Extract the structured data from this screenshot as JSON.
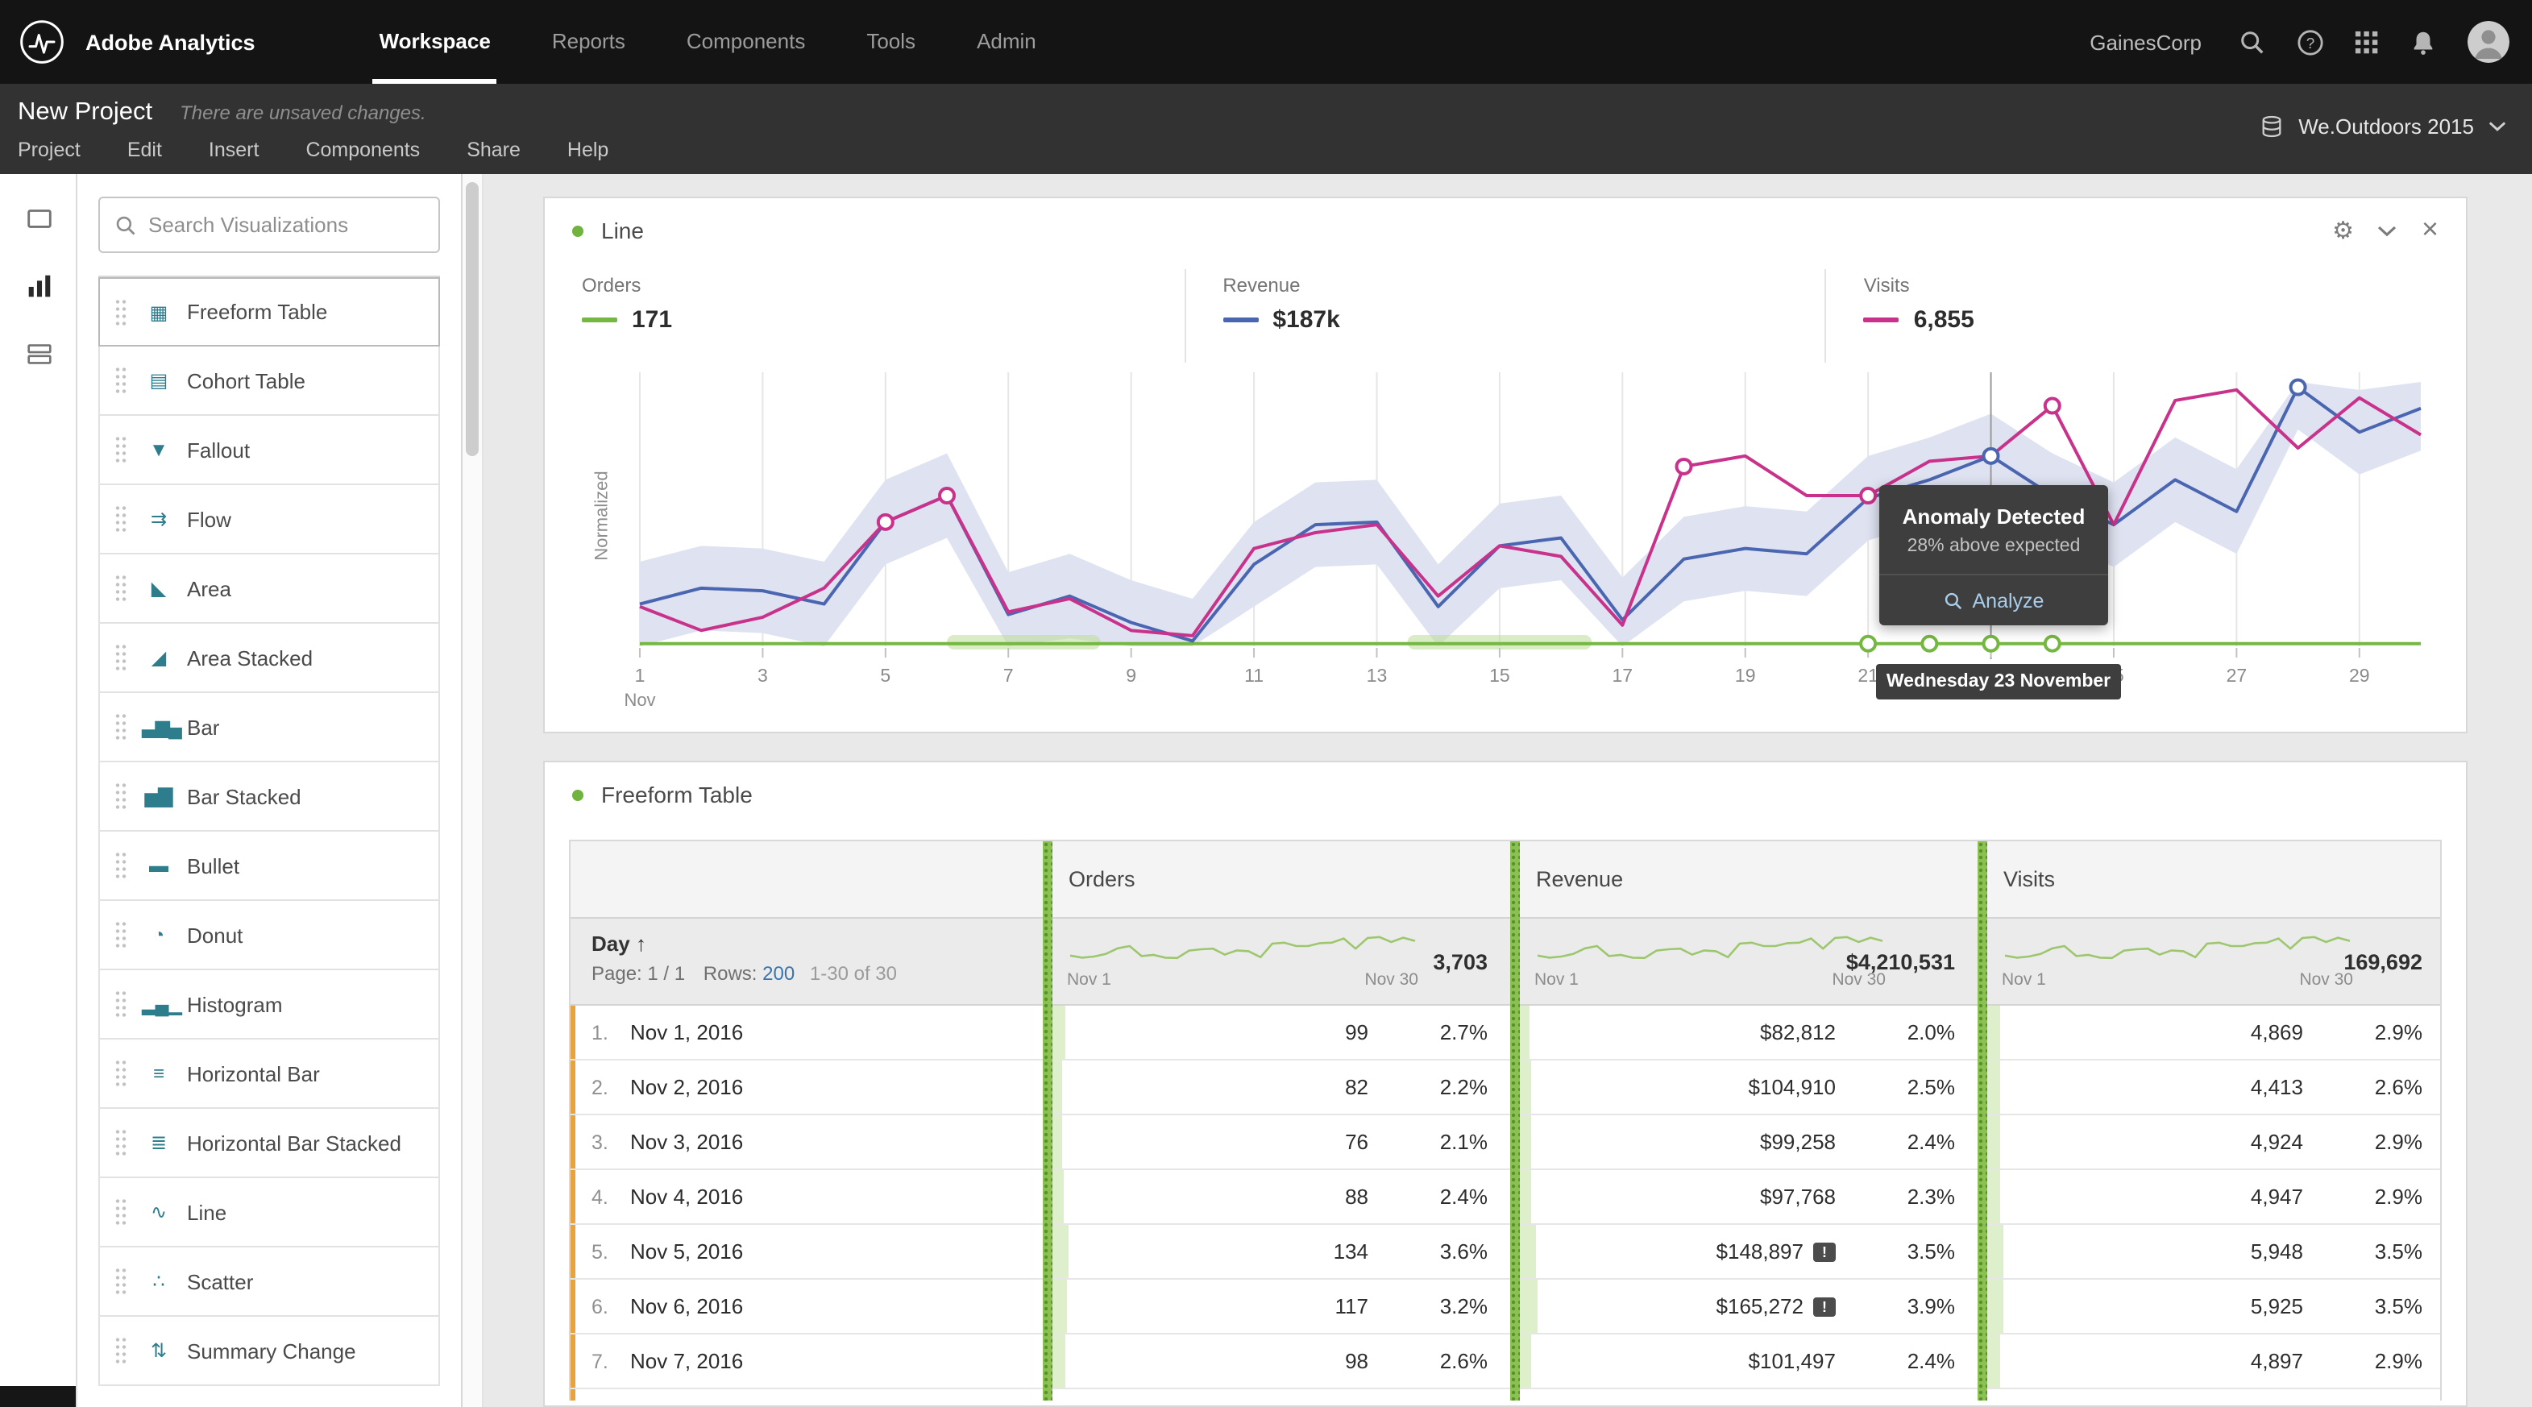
{
  "colors": {
    "green": "#75b841",
    "blue": "#4a66b0",
    "pink": "#c9328b",
    "band": "#dfe3f1",
    "orders_glow": "#bcdc96",
    "orange_accent": "#e8a33d",
    "link_blue": "#3b74ad"
  },
  "topnav": {
    "brand": "Adobe Analytics",
    "items": [
      {
        "label": "Workspace",
        "active": true
      },
      {
        "label": "Reports",
        "active": false
      },
      {
        "label": "Components",
        "active": false
      },
      {
        "label": "Tools",
        "active": false
      },
      {
        "label": "Admin",
        "active": false
      }
    ],
    "company": "GainesCorp"
  },
  "projectbar": {
    "title": "New Project",
    "unsaved_note": "There are unsaved changes.",
    "menu": [
      "Project",
      "Edit",
      "Insert",
      "Components",
      "Share",
      "Help"
    ],
    "report_suite": "We.Outdoors 2015"
  },
  "viz_panel": {
    "search_placeholder": "Search Visualizations",
    "items": [
      {
        "label": "Freeform Table",
        "icon": "freeform-table-icon",
        "glyph": "▦"
      },
      {
        "label": "Cohort Table",
        "icon": "cohort-table-icon",
        "glyph": "▤"
      },
      {
        "label": "Fallout",
        "icon": "fallout-icon",
        "glyph": "▼"
      },
      {
        "label": "Flow",
        "icon": "flow-icon",
        "glyph": "⇉"
      },
      {
        "label": "Area",
        "icon": "area-icon",
        "glyph": "◣"
      },
      {
        "label": "Area Stacked",
        "icon": "area-stacked-icon",
        "glyph": "◢"
      },
      {
        "label": "Bar",
        "icon": "bar-icon",
        "glyph": "▃▆▄"
      },
      {
        "label": "Bar Stacked",
        "icon": "bar-stacked-icon",
        "glyph": "▅▇"
      },
      {
        "label": "Bullet",
        "icon": "bullet-icon",
        "glyph": "▬"
      },
      {
        "label": "Donut",
        "icon": "donut-icon",
        "glyph": "◔"
      },
      {
        "label": "Histogram",
        "icon": "histogram-icon",
        "glyph": "▂▄▁"
      },
      {
        "label": "Horizontal Bar",
        "icon": "horizontal-bar-icon",
        "glyph": "≡"
      },
      {
        "label": "Horizontal Bar Stacked",
        "icon": "horizontal-bar-stacked-icon",
        "glyph": "≣"
      },
      {
        "label": "Line",
        "icon": "line-icon",
        "glyph": "∿"
      },
      {
        "label": "Scatter",
        "icon": "scatter-icon",
        "glyph": "∴"
      },
      {
        "label": "Summary Change",
        "icon": "summary-change-icon",
        "glyph": "⇅"
      }
    ]
  },
  "line_chart": {
    "title": "Line",
    "y_axis_label": "Normalized",
    "x_month_label": "Nov",
    "x_ticks": [
      1,
      3,
      5,
      7,
      9,
      11,
      13,
      15,
      17,
      19,
      21,
      23,
      25,
      27,
      29
    ],
    "days": 30,
    "hover_day": 23,
    "date_label": "Wednesday 23 November",
    "tooltip": {
      "title": "Anomaly Detected",
      "subtitle": "28% above expected",
      "action_label": "Analyze"
    },
    "legend": [
      {
        "name": "Orders",
        "value": "171",
        "color": "#75b841"
      },
      {
        "name": "Revenue",
        "value": "$187k",
        "color": "#4a66b0"
      },
      {
        "name": "Visits",
        "value": "6,855",
        "color": "#c9328b"
      }
    ],
    "band_offset": 16,
    "orders_band_ranges": [
      [
        6,
        8.5
      ],
      [
        13.5,
        16.5
      ]
    ],
    "series": {
      "orders": [
        1,
        1,
        1,
        1,
        1,
        1,
        1,
        1,
        1,
        1,
        1,
        1,
        1,
        1,
        1,
        1,
        1,
        1,
        1,
        1,
        1,
        1,
        1,
        1,
        1,
        1,
        1,
        1,
        1,
        1
      ],
      "revenue": [
        16,
        22,
        21,
        16,
        47,
        57,
        12,
        19,
        9,
        2,
        31,
        46,
        47,
        15,
        38,
        41,
        10,
        33,
        37,
        35,
        56,
        63,
        72,
        57,
        46,
        63,
        51,
        98,
        81,
        90
      ],
      "visits": [
        15,
        6,
        11,
        22,
        47,
        57,
        13,
        18,
        6,
        4,
        37,
        43,
        46,
        19,
        38,
        34,
        8,
        68,
        72,
        57,
        57,
        70,
        72,
        91,
        46,
        93,
        97,
        75,
        94,
        80
      ]
    },
    "anomalies": [
      {
        "series": "visits",
        "day": 5
      },
      {
        "series": "visits",
        "day": 6
      },
      {
        "series": "visits",
        "day": 18
      },
      {
        "series": "visits",
        "day": 21
      },
      {
        "series": "revenue",
        "day": 23
      },
      {
        "series": "visits",
        "day": 24
      },
      {
        "series": "revenue",
        "day": 28
      },
      {
        "series": "orders",
        "day": 21
      },
      {
        "series": "orders",
        "day": 22
      },
      {
        "series": "orders",
        "day": 23
      },
      {
        "series": "orders",
        "day": 24
      }
    ]
  },
  "freeform_table": {
    "title": "Freeform Table",
    "dim_label": "Day",
    "sort_arrow": "↑",
    "pagination_prefix": "Page: 1 / 1",
    "rows_label": "Rows:",
    "rows_value": "200",
    "range_label": "1-30 of 30",
    "spark_start_label": "Nov 1",
    "spark_end_label": "Nov 30",
    "columns": [
      {
        "name": "Orders",
        "total": "3,703"
      },
      {
        "name": "Revenue",
        "total": "$4,210,531"
      },
      {
        "name": "Visits",
        "total": "169,692"
      }
    ],
    "rows": [
      {
        "num": "1.",
        "day": "Nov 1, 2016",
        "cells": [
          {
            "v": "99",
            "p": "2.7%"
          },
          {
            "v": "$82,812",
            "p": "2.0%"
          },
          {
            "v": "4,869",
            "p": "2.9%"
          }
        ]
      },
      {
        "num": "2.",
        "day": "Nov 2, 2016",
        "cells": [
          {
            "v": "82",
            "p": "2.2%"
          },
          {
            "v": "$104,910",
            "p": "2.5%"
          },
          {
            "v": "4,413",
            "p": "2.6%"
          }
        ]
      },
      {
        "num": "3.",
        "day": "Nov 3, 2016",
        "cells": [
          {
            "v": "76",
            "p": "2.1%"
          },
          {
            "v": "$99,258",
            "p": "2.4%"
          },
          {
            "v": "4,924",
            "p": "2.9%"
          }
        ]
      },
      {
        "num": "4.",
        "day": "Nov 4, 2016",
        "cells": [
          {
            "v": "88",
            "p": "2.4%"
          },
          {
            "v": "$97,768",
            "p": "2.3%"
          },
          {
            "v": "4,947",
            "p": "2.9%"
          }
        ]
      },
      {
        "num": "5.",
        "day": "Nov 5, 2016",
        "cells": [
          {
            "v": "134",
            "p": "3.6%"
          },
          {
            "v": "$148,897",
            "p": "3.5%",
            "badge": true
          },
          {
            "v": "5,948",
            "p": "3.5%"
          }
        ]
      },
      {
        "num": "6.",
        "day": "Nov 6, 2016",
        "cells": [
          {
            "v": "117",
            "p": "3.2%"
          },
          {
            "v": "$165,272",
            "p": "3.9%",
            "badge": true
          },
          {
            "v": "5,925",
            "p": "3.5%"
          }
        ]
      },
      {
        "num": "7.",
        "day": "Nov 7, 2016",
        "cells": [
          {
            "v": "98",
            "p": "2.6%"
          },
          {
            "v": "$101,497",
            "p": "2.4%"
          },
          {
            "v": "4,897",
            "p": "2.9%"
          }
        ]
      }
    ]
  }
}
